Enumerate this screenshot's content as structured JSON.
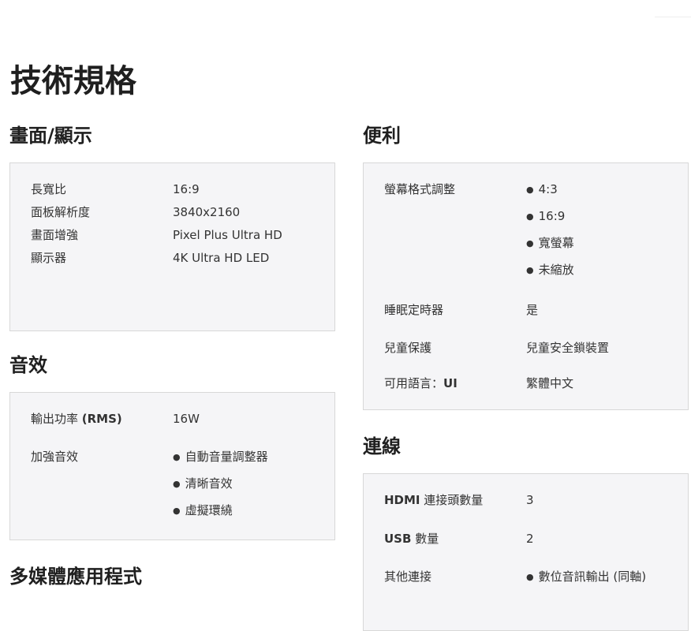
{
  "page_title": "技術規格",
  "display": {
    "title": "畫面/顯示",
    "rows": [
      {
        "label": "長寬比",
        "value": "16:9"
      },
      {
        "label": "面板解析度",
        "value": "3840x2160"
      },
      {
        "label": "畫面增強",
        "value": "Pixel Plus Ultra HD"
      },
      {
        "label": "顯示器",
        "value": "4K Ultra HD LED"
      }
    ]
  },
  "sound": {
    "title": "音效",
    "output_label_prefix": "輸出功率 ",
    "output_label_suffix": "(RMS)",
    "output_value": "16W",
    "enhance_label": "加強音效",
    "enhance_items": [
      "自動音量調整器",
      "清晰音效",
      "虛擬環繞"
    ]
  },
  "multimedia": {
    "title": "多媒體應用程式"
  },
  "convenience": {
    "title": "便利",
    "format_label": "螢幕格式調整",
    "format_items": [
      "4:3",
      "16:9",
      "寬螢幕",
      "未縮放"
    ],
    "sleep_label": "睡眠定時器",
    "sleep_value": "是",
    "child_label": "兒童保護",
    "child_value": "兒童安全鎖裝置",
    "lang_label_prefix": "可用語言：",
    "lang_label_suffix": "UI",
    "lang_value": "繁體中文"
  },
  "connectivity": {
    "title": "連線",
    "hdmi_label_prefix": "HDMI",
    "hdmi_label_suffix": " 連接頭數量",
    "hdmi_value": "3",
    "usb_label_prefix": "USB",
    "usb_label_suffix": " 數量",
    "usb_value": "2",
    "other_label": "其他連接",
    "other_items": [
      "數位音訊輸出 (同軸)"
    ]
  }
}
